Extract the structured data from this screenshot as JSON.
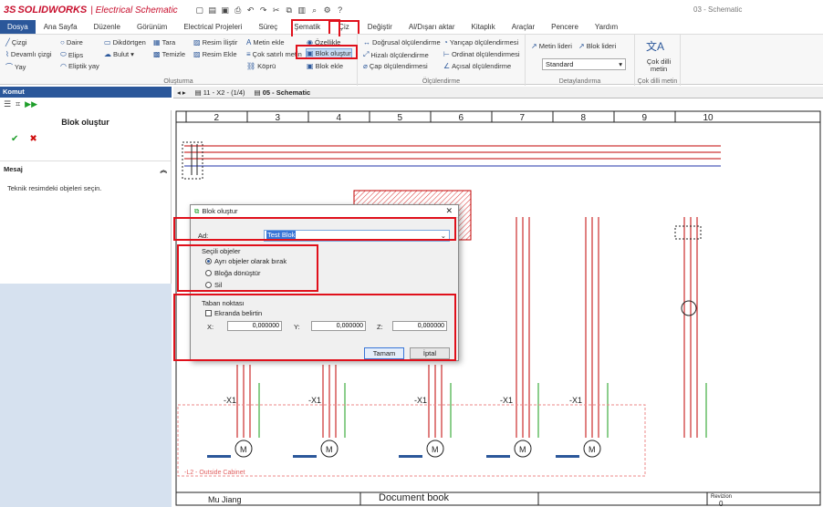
{
  "app": {
    "brand": "SOLIDWORKS",
    "product": "Electrical Schematic",
    "window_title": "03 - Schematic"
  },
  "tabs": [
    "Dosya",
    "Ana Sayfa",
    "Düzenle",
    "Görünüm",
    "Electrical Projeleri",
    "Süreç",
    "Şematik",
    "Çiz",
    "Değiştir",
    "Al/Dışarı aktar",
    "Kitaplık",
    "Araçlar",
    "Pencere",
    "Yardım"
  ],
  "ribbon": {
    "draw": [
      "Çizgi",
      "Daire",
      "Dikdörtgen",
      "Devamlı çizgi",
      "Elips",
      "Bulut",
      "Yay",
      "Eliptik yay",
      "Tara",
      "Resim İliştir",
      "Temizle",
      "Resim Ekle",
      "Metin ekle",
      "Çok satırlı metin",
      "Köprü",
      "Özellikle",
      "Blok oluştur",
      "Blok ekle"
    ],
    "draw_caption": "Oluşturma",
    "dim": [
      "Doğrusal ölçülendirme",
      "Yarıçap ölçülendirmesi",
      "Hizalı ölçülendirme",
      "Ordinat ölçülendirmesi",
      "Çap ölçülendirmesi",
      "Açısal ölçülendirme"
    ],
    "dim_caption": "Ölçülendirme",
    "detail": [
      "Metin lideri",
      "Blok lideri"
    ],
    "detail_select": "Standard",
    "detail_caption": "Detaylandırma",
    "multilang": "Çok dilli metin",
    "multilang_caption": "Çok dilli metin"
  },
  "panel": {
    "header": "Komut",
    "title": "Blok oluştur",
    "section": "Mesaj",
    "message": "Teknik resimdeki objeleri seçin."
  },
  "doctabs": [
    "11 - X2 - (1/4)",
    "05 - Schematic"
  ],
  "sheet": {
    "columns": [
      "2",
      "3",
      "4",
      "5",
      "6",
      "7",
      "8",
      "9",
      "10"
    ],
    "x1_labels": [
      "-X1",
      "-X1",
      "-X1",
      "-X1",
      "-X1"
    ],
    "outside_cabinet": "-L2 - Outside Cabinet",
    "footer_author": "Mu Jiang",
    "footer_doc": "Document book",
    "revision_label": "Revizion",
    "revision_value": "0"
  },
  "dialog": {
    "title": "Blok oluştur",
    "name_label": "Ad:",
    "name_value": "Test Blok",
    "objects_group": "Seçili objeler",
    "radio_options": [
      "Ayrı objeler olarak bırak",
      "Bloğa dönüştür",
      "Sil"
    ],
    "base_group": "Taban noktası",
    "checkbox_label": "Ekranda belirtin",
    "x_label": "X:",
    "y_label": "Y:",
    "z_label": "Z:",
    "x_value": "0,000000",
    "y_value": "0,000000",
    "z_value": "0,000000",
    "ok": "Tamam",
    "cancel": "İptal"
  },
  "colors": {
    "accent": "#2b579a",
    "highlight": "#e0101b",
    "wire_red": "#c00000",
    "wire_green": "#1a9e1a"
  }
}
